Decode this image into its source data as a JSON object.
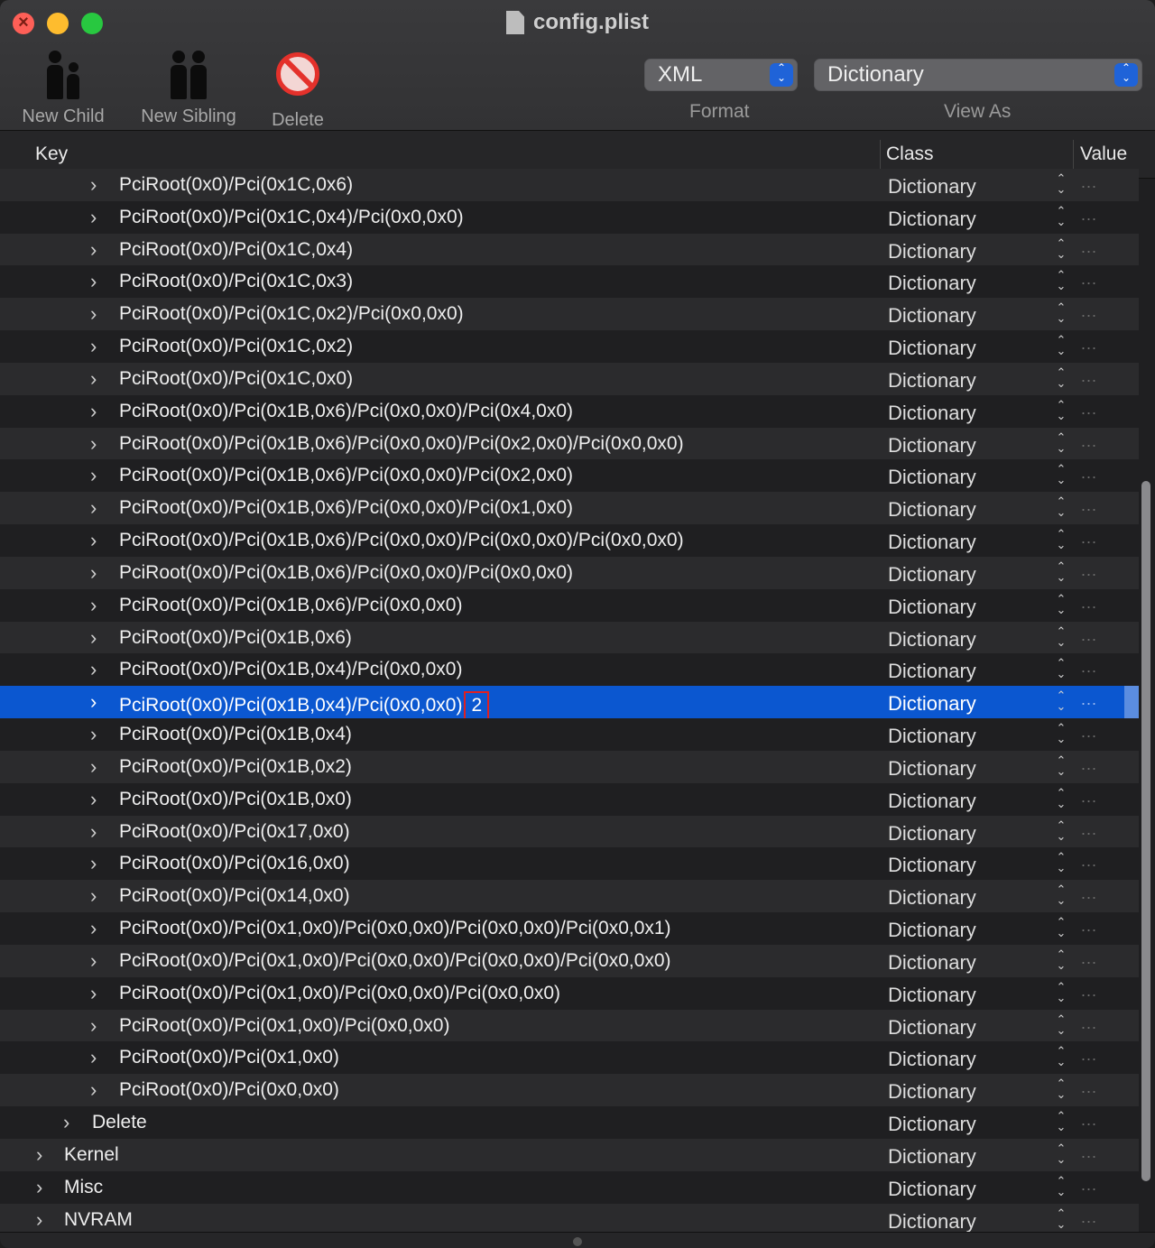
{
  "window": {
    "title": "config.plist"
  },
  "toolbar": {
    "new_child": "New Child",
    "new_sibling": "New Sibling",
    "delete": "Delete",
    "format_value": "XML",
    "format_label": "Format",
    "view_as_value": "Dictionary",
    "view_as_label": "View As"
  },
  "columns": {
    "key": "Key",
    "class": "Class",
    "value": "Value"
  },
  "colors": {
    "selection": "#0b57d0",
    "edit_outline": "#e02020",
    "stepper": "#1f63d8"
  },
  "rows": [
    {
      "key": "PciRoot(0x0)/Pci(0x1C,0x6)",
      "level": 2,
      "class": "Dictionary"
    },
    {
      "key": "PciRoot(0x0)/Pci(0x1C,0x4)/Pci(0x0,0x0)",
      "level": 2,
      "class": "Dictionary"
    },
    {
      "key": "PciRoot(0x0)/Pci(0x1C,0x4)",
      "level": 2,
      "class": "Dictionary"
    },
    {
      "key": "PciRoot(0x0)/Pci(0x1C,0x3)",
      "level": 2,
      "class": "Dictionary"
    },
    {
      "key": "PciRoot(0x0)/Pci(0x1C,0x2)/Pci(0x0,0x0)",
      "level": 2,
      "class": "Dictionary"
    },
    {
      "key": "PciRoot(0x0)/Pci(0x1C,0x2)",
      "level": 2,
      "class": "Dictionary"
    },
    {
      "key": "PciRoot(0x0)/Pci(0x1C,0x0)",
      "level": 2,
      "class": "Dictionary"
    },
    {
      "key": "PciRoot(0x0)/Pci(0x1B,0x6)/Pci(0x0,0x0)/Pci(0x4,0x0)",
      "level": 2,
      "class": "Dictionary"
    },
    {
      "key": "PciRoot(0x0)/Pci(0x1B,0x6)/Pci(0x0,0x0)/Pci(0x2,0x0)/Pci(0x0,0x0)",
      "level": 2,
      "class": "Dictionary"
    },
    {
      "key": "PciRoot(0x0)/Pci(0x1B,0x6)/Pci(0x0,0x0)/Pci(0x2,0x0)",
      "level": 2,
      "class": "Dictionary"
    },
    {
      "key": "PciRoot(0x0)/Pci(0x1B,0x6)/Pci(0x0,0x0)/Pci(0x1,0x0)",
      "level": 2,
      "class": "Dictionary"
    },
    {
      "key": "PciRoot(0x0)/Pci(0x1B,0x6)/Pci(0x0,0x0)/Pci(0x0,0x0)/Pci(0x0,0x0)",
      "level": 2,
      "class": "Dictionary"
    },
    {
      "key": "PciRoot(0x0)/Pci(0x1B,0x6)/Pci(0x0,0x0)/Pci(0x0,0x0)",
      "level": 2,
      "class": "Dictionary"
    },
    {
      "key": "PciRoot(0x0)/Pci(0x1B,0x6)/Pci(0x0,0x0)",
      "level": 2,
      "class": "Dictionary"
    },
    {
      "key": "PciRoot(0x0)/Pci(0x1B,0x6)",
      "level": 2,
      "class": "Dictionary"
    },
    {
      "key": "PciRoot(0x0)/Pci(0x1B,0x4)/Pci(0x0,0x0)",
      "level": 2,
      "class": "Dictionary"
    },
    {
      "key": "PciRoot(0x0)/Pci(0x1B,0x4)/Pci(0x0,0x0)",
      "edit_suffix": "2",
      "level": 2,
      "class": "Dictionary",
      "selected": true
    },
    {
      "key": "PciRoot(0x0)/Pci(0x1B,0x4)",
      "level": 2,
      "class": "Dictionary"
    },
    {
      "key": "PciRoot(0x0)/Pci(0x1B,0x2)",
      "level": 2,
      "class": "Dictionary"
    },
    {
      "key": "PciRoot(0x0)/Pci(0x1B,0x0)",
      "level": 2,
      "class": "Dictionary"
    },
    {
      "key": "PciRoot(0x0)/Pci(0x17,0x0)",
      "level": 2,
      "class": "Dictionary"
    },
    {
      "key": "PciRoot(0x0)/Pci(0x16,0x0)",
      "level": 2,
      "class": "Dictionary"
    },
    {
      "key": "PciRoot(0x0)/Pci(0x14,0x0)",
      "level": 2,
      "class": "Dictionary"
    },
    {
      "key": "PciRoot(0x0)/Pci(0x1,0x0)/Pci(0x0,0x0)/Pci(0x0,0x0)/Pci(0x0,0x1)",
      "level": 2,
      "class": "Dictionary"
    },
    {
      "key": "PciRoot(0x0)/Pci(0x1,0x0)/Pci(0x0,0x0)/Pci(0x0,0x0)/Pci(0x0,0x0)",
      "level": 2,
      "class": "Dictionary"
    },
    {
      "key": "PciRoot(0x0)/Pci(0x1,0x0)/Pci(0x0,0x0)/Pci(0x0,0x0)",
      "level": 2,
      "class": "Dictionary"
    },
    {
      "key": "PciRoot(0x0)/Pci(0x1,0x0)/Pci(0x0,0x0)",
      "level": 2,
      "class": "Dictionary"
    },
    {
      "key": "PciRoot(0x0)/Pci(0x1,0x0)",
      "level": 2,
      "class": "Dictionary"
    },
    {
      "key": "PciRoot(0x0)/Pci(0x0,0x0)",
      "level": 2,
      "class": "Dictionary"
    },
    {
      "key": "Delete",
      "level": 1,
      "class": "Dictionary"
    },
    {
      "key": "Kernel",
      "level": 0,
      "class": "Dictionary"
    },
    {
      "key": "Misc",
      "level": 0,
      "class": "Dictionary"
    },
    {
      "key": "NVRAM",
      "level": 0,
      "class": "Dictionary"
    }
  ]
}
